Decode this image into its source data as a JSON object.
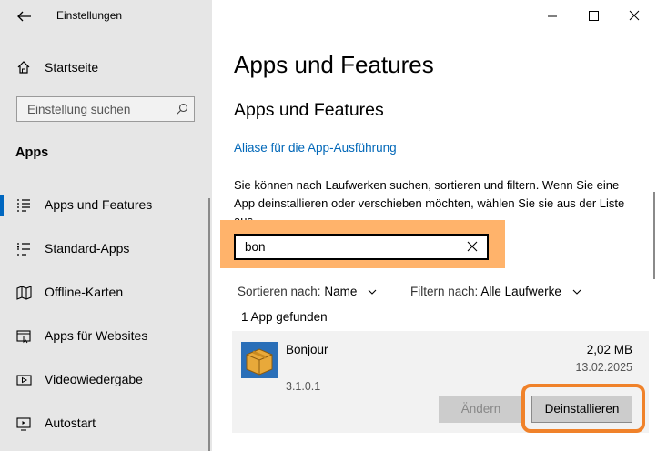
{
  "window": {
    "title": "Einstellungen"
  },
  "sidebar": {
    "home_label": "Startseite",
    "search_placeholder": "Einstellung suchen",
    "section_title": "Apps",
    "items": [
      {
        "label": "Apps und Features",
        "icon": "apps-features-icon",
        "active": true
      },
      {
        "label": "Standard-Apps",
        "icon": "default-apps-icon"
      },
      {
        "label": "Offline-Karten",
        "icon": "map-icon"
      },
      {
        "label": "Apps für Websites",
        "icon": "web-apps-icon"
      },
      {
        "label": "Videowiedergabe",
        "icon": "video-icon"
      },
      {
        "label": "Autostart",
        "icon": "startup-icon"
      }
    ]
  },
  "main": {
    "page_title": "Apps und Features",
    "section_title": "Apps und Features",
    "alias_link": "Aliase für die App-Ausführung",
    "description": "Sie können nach Laufwerken suchen, sortieren und filtern. Wenn Sie eine App deinstallieren oder verschieben möchten, wählen Sie sie aus der Liste aus.",
    "search_value": "bon",
    "sort_label": "Sortieren nach:",
    "sort_value": "Name",
    "filter_label": "Filtern nach:",
    "filter_value": "Alle Laufwerke",
    "result_count": "1 App gefunden",
    "app": {
      "name": "Bonjour",
      "size": "2,02 MB",
      "date": "13.02.2025",
      "version": "3.1.0.1",
      "modify_label": "Ändern",
      "uninstall_label": "Deinstallieren"
    }
  },
  "colors": {
    "accent": "#0067c0",
    "link": "#0067b8",
    "highlight": "#ffb36b",
    "ring": "#f0822a",
    "sidebar_bg": "#e6e6e6"
  }
}
